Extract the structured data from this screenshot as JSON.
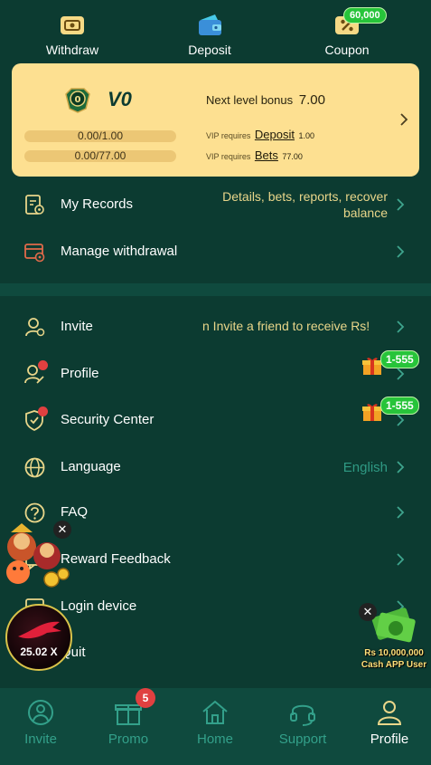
{
  "top_actions": [
    {
      "label": "Withdraw",
      "icon": "withdraw-ticket-icon"
    },
    {
      "label": "Deposit",
      "icon": "wallet-icon"
    },
    {
      "label": "Coupon",
      "icon": "coupon-percent-icon",
      "badge": "60,000"
    }
  ],
  "vip": {
    "level": "V0",
    "deposit_progress": "0.00/1.00",
    "bets_progress": "0.00/77.00",
    "next_bonus_label": "Next level bonus",
    "next_bonus_value": "7.00",
    "req_prefix": "VIP requires",
    "req_deposit_link": "Deposit",
    "req_deposit_amount": "1.00",
    "req_bets_link": "Bets",
    "req_bets_amount": "77.00"
  },
  "menu_top": [
    {
      "label": "My Records",
      "icon": "records-icon",
      "subtext_line1": "Details, bets, reports, recover",
      "subtext_line2": "balance"
    },
    {
      "label": "Manage withdrawal",
      "icon": "manage-withdrawal-icon"
    }
  ],
  "menu_main": [
    {
      "label": "Invite",
      "icon": "invite-user-icon",
      "marquee": "n  Invite a friend to receive Rs!"
    },
    {
      "label": "Profile",
      "icon": "profile-edit-icon",
      "badge": "1-555"
    },
    {
      "label": "Security Center",
      "icon": "shield-check-icon",
      "badge": "1-555"
    },
    {
      "label": "Language",
      "icon": "globe-icon",
      "value": "English"
    },
    {
      "label": "FAQ",
      "icon": "question-icon"
    },
    {
      "label": "Reward Feedback",
      "icon": "feedback-icon"
    },
    {
      "label": "Login device",
      "icon": "device-icon"
    },
    {
      "label": "Quit",
      "icon": "quit-icon"
    }
  ],
  "floating": {
    "aviator_multiplier": "25.02 X",
    "cash_line1": "Rs 10,000,000",
    "cash_line2": "Cash APP User",
    "close_glyph": "✕"
  },
  "bottom_nav": [
    {
      "label": "Invite",
      "icon": "invite-handshake-icon"
    },
    {
      "label": "Promo",
      "icon": "gift-icon",
      "badge": "5"
    },
    {
      "label": "Home",
      "icon": "home-icon"
    },
    {
      "label": "Support",
      "icon": "headset-icon"
    },
    {
      "label": "Profile",
      "icon": "person-icon",
      "active": true
    }
  ],
  "colors": {
    "background": "#0c3b31",
    "card": "#fde091",
    "accent_gold": "#e9d68a",
    "nav_inactive": "#33a08a",
    "badge_green": "#27c43a",
    "badge_red": "#e04040"
  }
}
